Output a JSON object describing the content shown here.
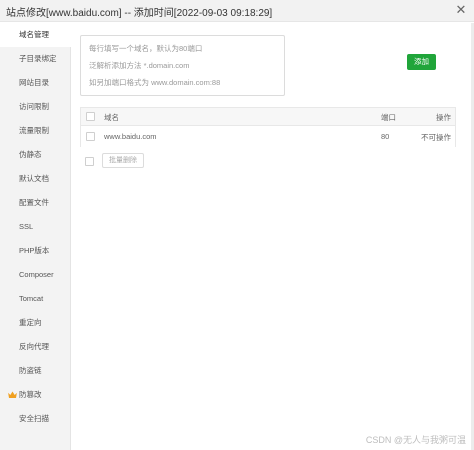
{
  "window": {
    "title": "站点修改[www.baidu.com] -- 添加时间[2022-09-03 09:18:29]",
    "close_icon": "close-icon"
  },
  "sidebar": {
    "items": [
      {
        "label": "域名管理",
        "active": true
      },
      {
        "label": "子目录绑定"
      },
      {
        "label": "网站目录"
      },
      {
        "label": "访问限制"
      },
      {
        "label": "流量限制"
      },
      {
        "label": "伪静态"
      },
      {
        "label": "默认文档"
      },
      {
        "label": "配置文件"
      },
      {
        "label": "SSL"
      },
      {
        "label": "PHP版本"
      },
      {
        "label": "Composer"
      },
      {
        "label": "Tomcat"
      },
      {
        "label": "重定向"
      },
      {
        "label": "反向代理"
      },
      {
        "label": "防盗链"
      },
      {
        "label": "防篡改",
        "icon": "vip-crown-icon",
        "icon_color": "#f0a020"
      },
      {
        "label": "安全扫描"
      }
    ]
  },
  "domain_form": {
    "tips": [
      "每行填写一个域名，默认为80端口",
      "泛解析添加方法 *.domain.com",
      "如另加端口格式为 www.domain.com:88"
    ],
    "add_label": "添加"
  },
  "table": {
    "columns": [
      "域名",
      "端口",
      "操作"
    ],
    "rows": [
      {
        "domain": "www.baidu.com",
        "port": "80",
        "action": "不可操作"
      }
    ]
  },
  "batch_delete_label": "批量删除",
  "watermark": "CSDN @无人与我粥可温",
  "colors": {
    "accent": "#20a53a",
    "sidebar_bg": "#f3f3f3"
  }
}
